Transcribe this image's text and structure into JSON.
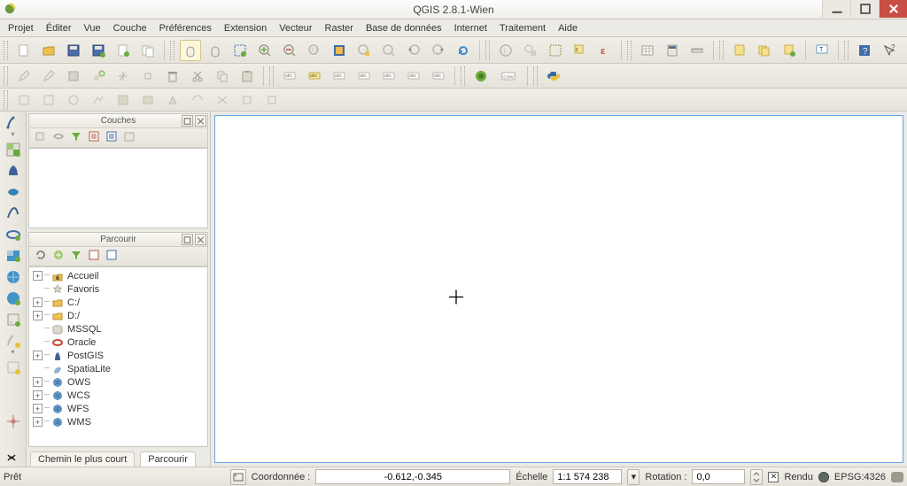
{
  "title": "QGIS 2.8.1-Wien",
  "menus": [
    "Projet",
    "Éditer",
    "Vue",
    "Couche",
    "Préférences",
    "Extension",
    "Vecteur",
    "Raster",
    "Base de données",
    "Internet",
    "Traitement",
    "Aide"
  ],
  "panels": {
    "layers": {
      "title": "Couches"
    },
    "browser": {
      "title": "Parcourir"
    }
  },
  "browser_tree": [
    {
      "expander": "plus",
      "icon": "folder-home",
      "label": "Accueil"
    },
    {
      "expander": "none",
      "icon": "star",
      "label": "Favoris"
    },
    {
      "expander": "plus",
      "icon": "folder",
      "label": "C:/"
    },
    {
      "expander": "plus",
      "icon": "folder",
      "label": "D:/"
    },
    {
      "expander": "none",
      "icon": "db-mssql",
      "label": "MSSQL"
    },
    {
      "expander": "none",
      "icon": "db-oracle",
      "label": "Oracle"
    },
    {
      "expander": "plus",
      "icon": "db-postgis",
      "label": "PostGIS"
    },
    {
      "expander": "none",
      "icon": "db-spatialite",
      "label": "SpatiaLite"
    },
    {
      "expander": "plus",
      "icon": "globe",
      "label": "OWS"
    },
    {
      "expander": "plus",
      "icon": "globe",
      "label": "WCS"
    },
    {
      "expander": "plus",
      "icon": "globe",
      "label": "WFS"
    },
    {
      "expander": "plus",
      "icon": "globe",
      "label": "WMS"
    }
  ],
  "tabs": {
    "shortest_path": "Chemin le plus court",
    "browser": "Parcourir"
  },
  "status": {
    "ready": "Prêt",
    "coord_label": "Coordonnée :",
    "coord_value": "-0.612,-0.345",
    "scale_label": "Échelle",
    "scale_value": "1:1 574 238",
    "rotation_label": "Rotation :",
    "rotation_value": "0,0",
    "render_label": "Rendu",
    "crs": "EPSG:4326"
  }
}
